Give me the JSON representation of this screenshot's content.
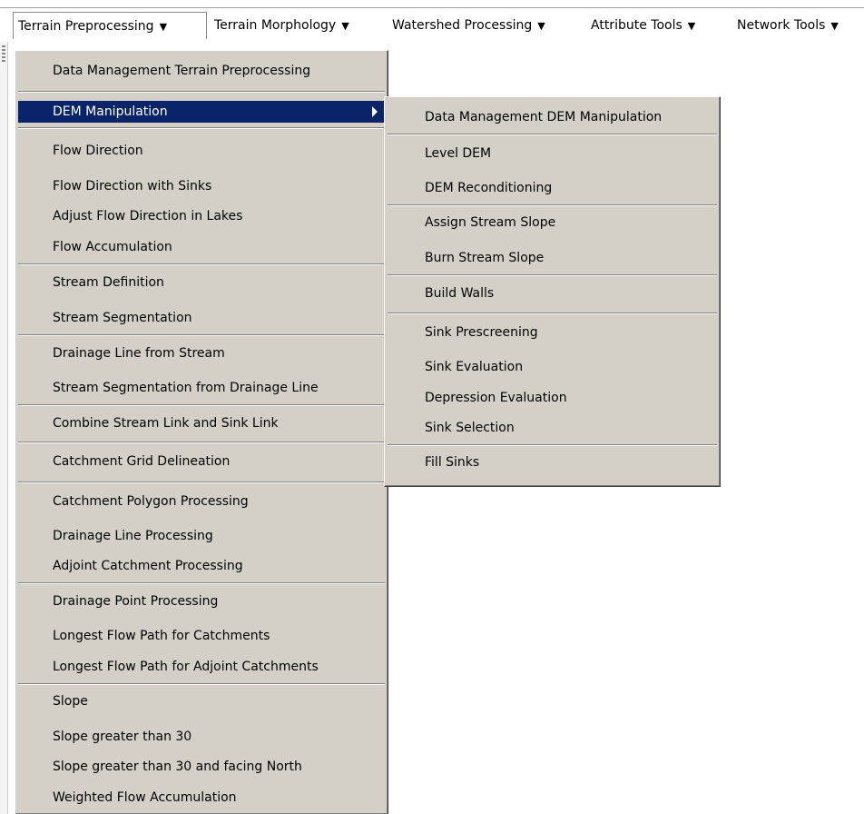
{
  "menubar": {
    "items": [
      {
        "label": "Terrain Preprocessing"
      },
      {
        "label": "Terrain Morphology"
      },
      {
        "label": "Watershed Processing"
      },
      {
        "label": "Attribute Tools"
      },
      {
        "label": "Network Tools"
      }
    ],
    "arrow": "▼"
  },
  "main_menu": {
    "items": [
      "Data Management Terrain Preprocessing",
      "DEM Manipulation",
      "Flow Direction",
      "Flow Direction with Sinks",
      "Adjust Flow Direction in Lakes",
      "Flow Accumulation",
      "Stream Definition",
      "Stream Segmentation",
      "Drainage Line from Stream",
      "Stream Segmentation from Drainage Line",
      "Combine Stream Link and Sink Link",
      "Catchment Grid Delineation",
      "Catchment Polygon Processing",
      "Drainage Line Processing",
      "Adjoint Catchment Processing",
      "Drainage Point Processing",
      "Longest Flow Path for Catchments",
      "Longest Flow Path for Adjoint Catchments",
      "Slope",
      "Slope greater than 30",
      "Slope greater than 30 and facing North",
      "Weighted Flow Accumulation"
    ],
    "highlighted": "DEM Manipulation"
  },
  "sub_menu": {
    "items": [
      "Data Management DEM Manipulation",
      "Level DEM",
      "DEM Reconditioning",
      "Assign Stream Slope",
      "Burn Stream Slope",
      "Build Walls",
      "Sink Prescreening",
      "Sink Evaluation",
      "Depression Evaluation",
      "Sink Selection",
      "Fill Sinks"
    ]
  },
  "colors": {
    "menu_bg": "#d4d0c8",
    "highlight_bg": "#0a246a",
    "highlight_text": "#ffffff"
  }
}
